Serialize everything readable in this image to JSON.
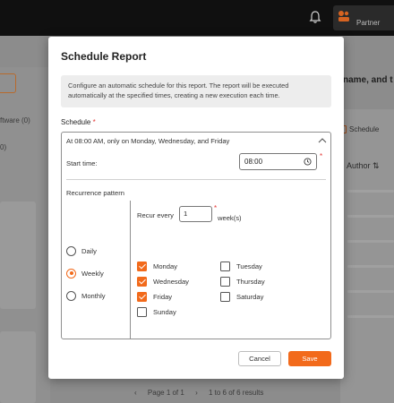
{
  "topbar": {
    "partner_label": "Partner"
  },
  "background": {
    "left_item_1": "ftware (0)",
    "left_item_2": "0)",
    "right_title": "name, and t",
    "schedule_link": "Schedule",
    "author_header": "Author",
    "sort_glyph": "⇅",
    "pager": {
      "prev": "‹",
      "page_label": "Page 1 of 1",
      "next": "›",
      "results": "1 to 6 of 6 results"
    }
  },
  "modal": {
    "title": "Schedule Report",
    "info_text": "Configure an automatic schedule for this report. The report will be executed automatically at the specified times, creating a new execution each time.",
    "schedule_label": "Schedule",
    "required_mark": "*",
    "summary": "At 08:00 AM, only on Monday, Wednesday, and Friday",
    "start_time_label": "Start time:",
    "start_time_value": "08:00",
    "recurrence_label": "Recurrence pattern",
    "patterns": [
      {
        "label": "Daily",
        "checked": false
      },
      {
        "label": "Weekly",
        "checked": true
      },
      {
        "label": "Monthly",
        "checked": false
      }
    ],
    "recur_every_label": "Recur every",
    "recur_every_value": "1",
    "recur_unit": "week(s)",
    "days": [
      {
        "label": "Monday",
        "checked": true
      },
      {
        "label": "Wednesday",
        "checked": true
      },
      {
        "label": "Friday",
        "checked": true
      },
      {
        "label": "Sunday",
        "checked": false
      },
      {
        "label": "Tuesday",
        "checked": false
      },
      {
        "label": "Thursday",
        "checked": false
      },
      {
        "label": "Saturday",
        "checked": false
      }
    ],
    "cancel_label": "Cancel",
    "save_label": "Save"
  },
  "colors": {
    "accent": "#f26a1b",
    "required": "#e53935",
    "overlay": "#8c8c8c"
  },
  "icons": [
    "bell-icon",
    "partner-logo-icon",
    "chevron-up-icon",
    "clock-icon",
    "schedule-icon"
  ]
}
